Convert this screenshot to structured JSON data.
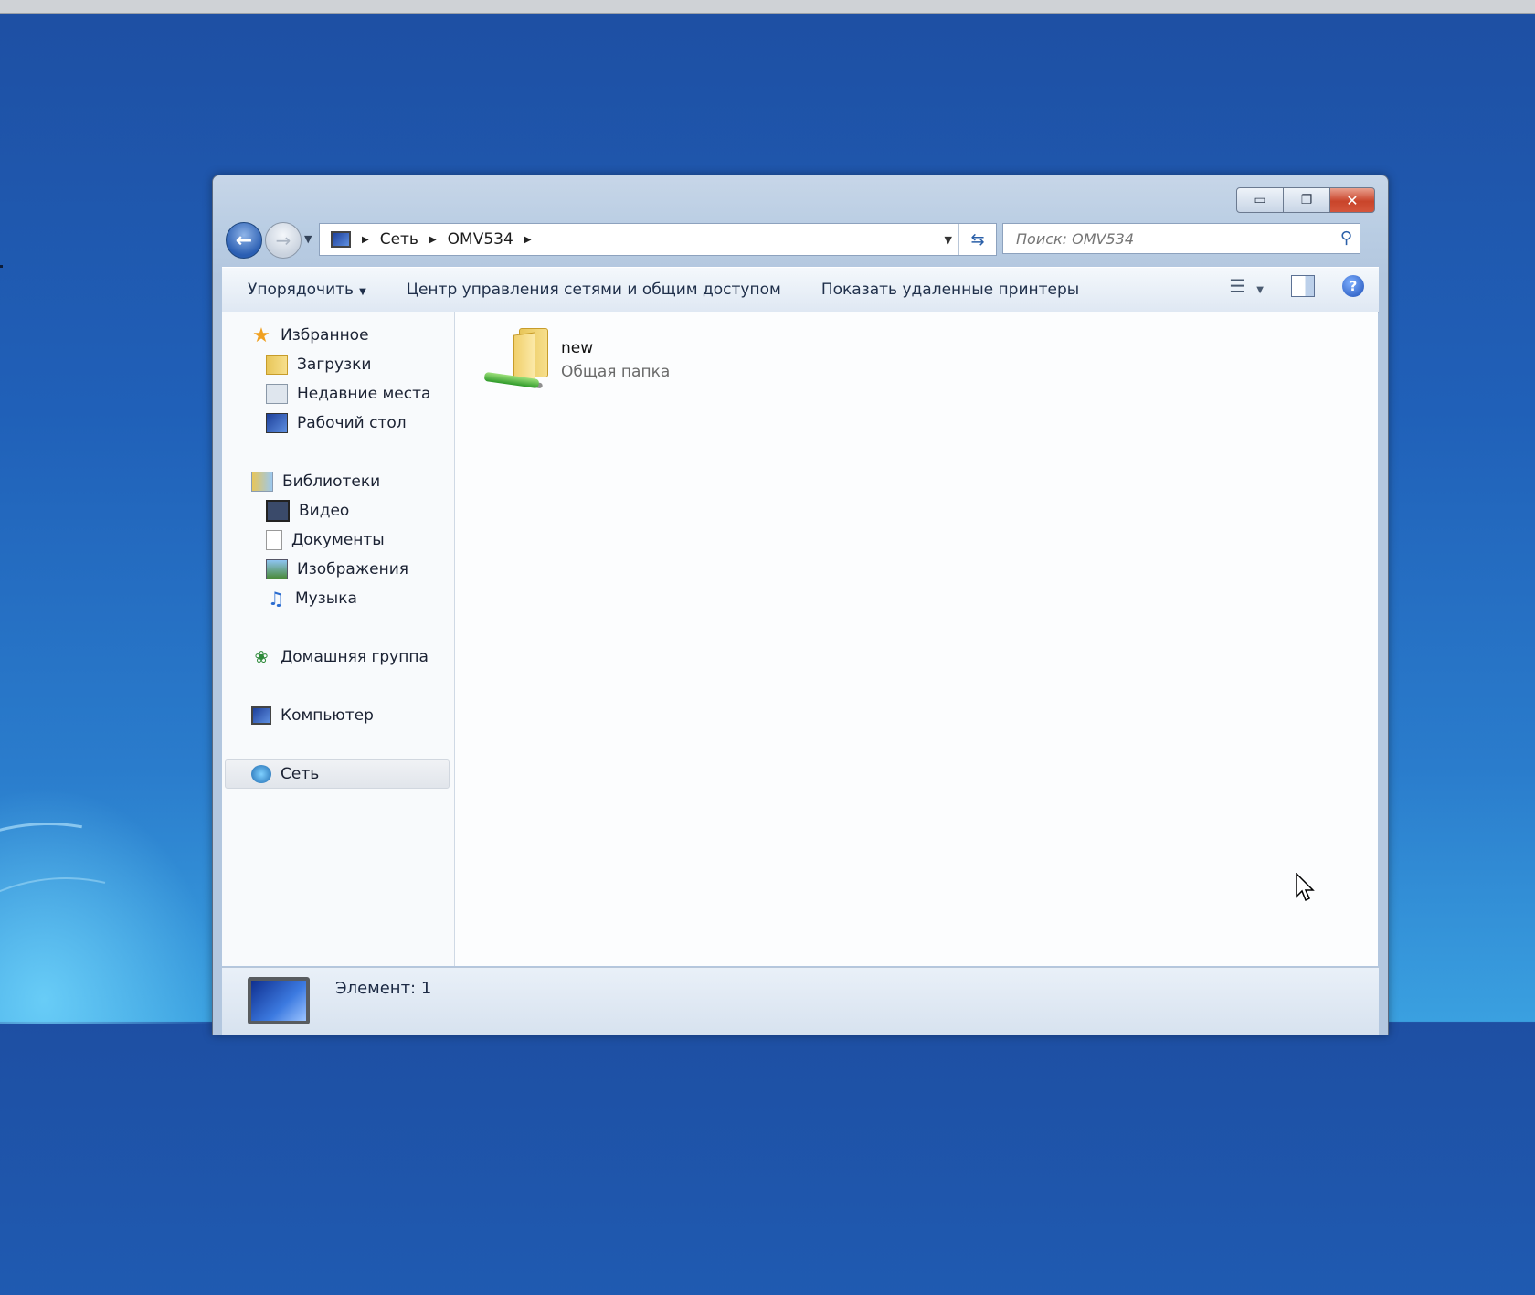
{
  "window": {
    "caption_buttons": {
      "minimize": "▭",
      "maximize": "❐",
      "close": "✕"
    }
  },
  "navigation": {
    "back_icon": "arrow-left",
    "forward_icon": "arrow-right",
    "breadcrumb": [
      "Сеть",
      "OMV534"
    ],
    "search_placeholder": "Поиск: OMV534"
  },
  "command_bar": {
    "organize": "Упорядочить",
    "network_center": "Центр управления сетями и общим доступом",
    "show_printers": "Показать удаленные принтеры"
  },
  "sidebar": {
    "favorites": {
      "label": "Избранное",
      "items": [
        "Загрузки",
        "Недавние места",
        "Рабочий стол"
      ]
    },
    "libraries": {
      "label": "Библиотеки",
      "items": [
        "Видео",
        "Документы",
        "Изображения",
        "Музыка"
      ]
    },
    "homegroup": "Домашняя группа",
    "computer": "Компьютер",
    "network": "Сеть",
    "selected": "Сеть"
  },
  "content": {
    "items": [
      {
        "name": "new",
        "type": "Общая папка"
      }
    ]
  },
  "status": {
    "text": "Элемент: 1"
  },
  "colors": {
    "desktop": "#2060b8",
    "close_button": "#c9442a",
    "accent": "#2a5fa8"
  }
}
